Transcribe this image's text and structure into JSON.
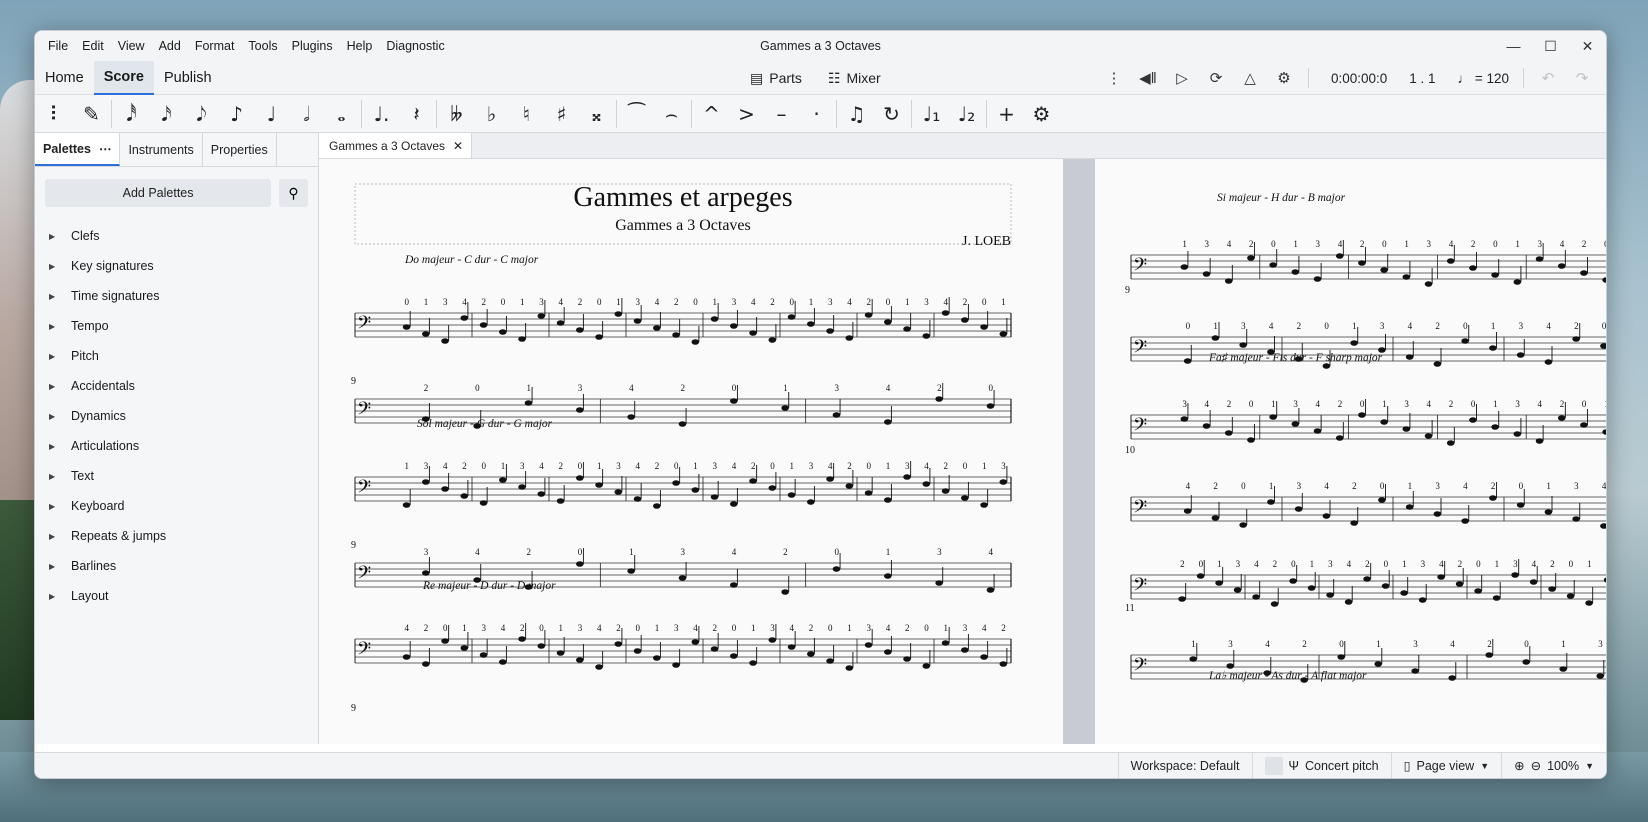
{
  "window": {
    "title": "Gammes a 3 Octaves"
  },
  "menu": [
    "File",
    "Edit",
    "View",
    "Add",
    "Format",
    "Tools",
    "Plugins",
    "Help",
    "Diagnostic"
  ],
  "tabs": [
    "Home",
    "Score",
    "Publish"
  ],
  "center": {
    "parts": "Parts",
    "mixer": "Mixer"
  },
  "playback": {
    "time": "0:00:00:0",
    "position": "1 . 1",
    "tempo": "♩ = 120"
  },
  "note_input": {
    "icons": [
      "grip-icon",
      "pen-icon",
      "64th-note-icon",
      "32nd-note-icon",
      "16th-note-icon",
      "eighth-note-icon",
      "quarter-note-icon",
      "half-note-icon",
      "whole-note-icon",
      "dotted-note-icon",
      "rest-icon",
      "double-flat-icon",
      "flat-icon",
      "natural-icon",
      "sharp-icon",
      "double-sharp-icon",
      "tie-icon",
      "slur-icon",
      "marcato-icon",
      "accent-icon",
      "tenuto-icon",
      "staccato-icon",
      "tuplet-icon",
      "flip-icon",
      "voice-1-icon",
      "voice-2-icon",
      "add-icon",
      "settings-icon"
    ],
    "glyphs": [
      "⠇",
      "✎",
      "𝅘𝅥𝅰",
      "𝅘𝅥𝅯",
      "𝅘𝅥𝅮",
      "♪",
      "♩",
      "𝅗𝅥",
      "𝅝",
      "♩.",
      "𝄽",
      "𝄫",
      "♭",
      "♮",
      "♯",
      "𝄪",
      "⁀",
      "⌢",
      "^",
      ">",
      "–",
      "·",
      "♫",
      "↻",
      "♩₁",
      "♩₂",
      "+",
      "⚙"
    ]
  },
  "sidebar": {
    "tabs": [
      "Palettes",
      "Instruments",
      "Properties"
    ],
    "add_palettes": "Add Palettes",
    "items": [
      "Clefs",
      "Key signatures",
      "Time signatures",
      "Tempo",
      "Pitch",
      "Accidentals",
      "Dynamics",
      "Articulations",
      "Text",
      "Keyboard",
      "Repeats & jumps",
      "Barlines",
      "Layout"
    ]
  },
  "document": {
    "tab": "Gammes a 3 Octaves"
  },
  "score": {
    "title": "Gammes et arpeges",
    "subtitle": "Gammes a 3 Octaves",
    "composer": "J. LOEB",
    "sections_p1": [
      "Do majeur - C dur - C major",
      "Sol majeur - G dur - G major",
      "Re majeur - D dur - D major"
    ],
    "sections_p2": [
      "Si majeur - H dur - B major",
      "Fa♯ majeur - Fis dur - F sharp major",
      "La♭ majeur - As dur - A flat major"
    ],
    "measure_numbers_p1": [
      "9",
      "9",
      "9"
    ],
    "measure_numbers_p2": [
      "9",
      "10",
      "11"
    ],
    "fingerings": [
      "0",
      "1",
      "3",
      "4",
      "2"
    ]
  },
  "status": {
    "workspace": "Workspace: Default",
    "concert_pitch": "Concert pitch",
    "page_view": "Page view",
    "zoom": "100%"
  },
  "colors": {
    "accent": "#2f6fdc"
  }
}
